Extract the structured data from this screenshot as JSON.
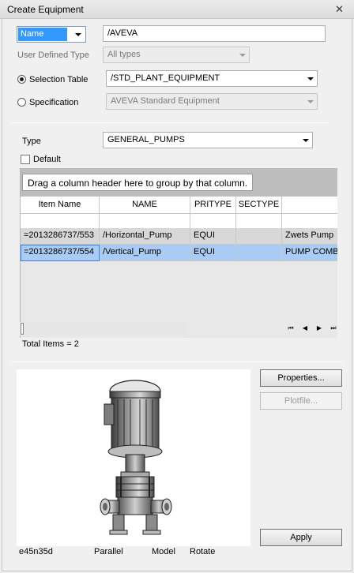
{
  "window": {
    "title": "Create Equipment",
    "close_glyph": "✕"
  },
  "form": {
    "name_mode": "Name",
    "name_value": "/AVEVA",
    "user_defined_type_label": "User Defined Type",
    "user_defined_type_value": "All types",
    "selection_table_label": "Selection Table",
    "selection_table_value": "/STD_PLANT_EQUIPMENT",
    "selection_table_checked": true,
    "specification_label": "Specification",
    "specification_value": "AVEVA Standard Equipment",
    "specification_checked": false,
    "type_label": "Type",
    "type_value": "GENERAL_PUMPS",
    "default_label": "Default",
    "default_checked": false
  },
  "grid": {
    "group_hint": "Drag a column header here to group by that column.",
    "columns": [
      "Item Name",
      "NAME",
      "PRITYPE",
      "SECTYPE"
    ],
    "rows": [
      {
        "item_name": "=2013286737/553",
        "name": "/Horizontal_Pump",
        "pritype": "EQUI",
        "sectype": "",
        "description": "Zwets Pump"
      },
      {
        "item_name": "=2013286737/554",
        "name": "/Vertical_Pump",
        "pritype": "EQUI",
        "sectype": "",
        "description": "PUMP COMB"
      }
    ],
    "total_items": "Total Items = 2",
    "nav": {
      "first": "⏮",
      "prev": "◀",
      "next": "▶",
      "last": "⏭"
    }
  },
  "buttons": {
    "properties": "Properties...",
    "plotfile": "Plotfile...",
    "apply": "Apply"
  },
  "preview": {
    "status_code": "e45n35d",
    "projection": "Parallel",
    "mode": "Model",
    "action": "Rotate"
  },
  "colors": {
    "selection_blue": "#3399ff",
    "selected_row": "#aacbf4",
    "row_gray": "#d8d8d8",
    "groupbar": "#bdbdbd"
  }
}
